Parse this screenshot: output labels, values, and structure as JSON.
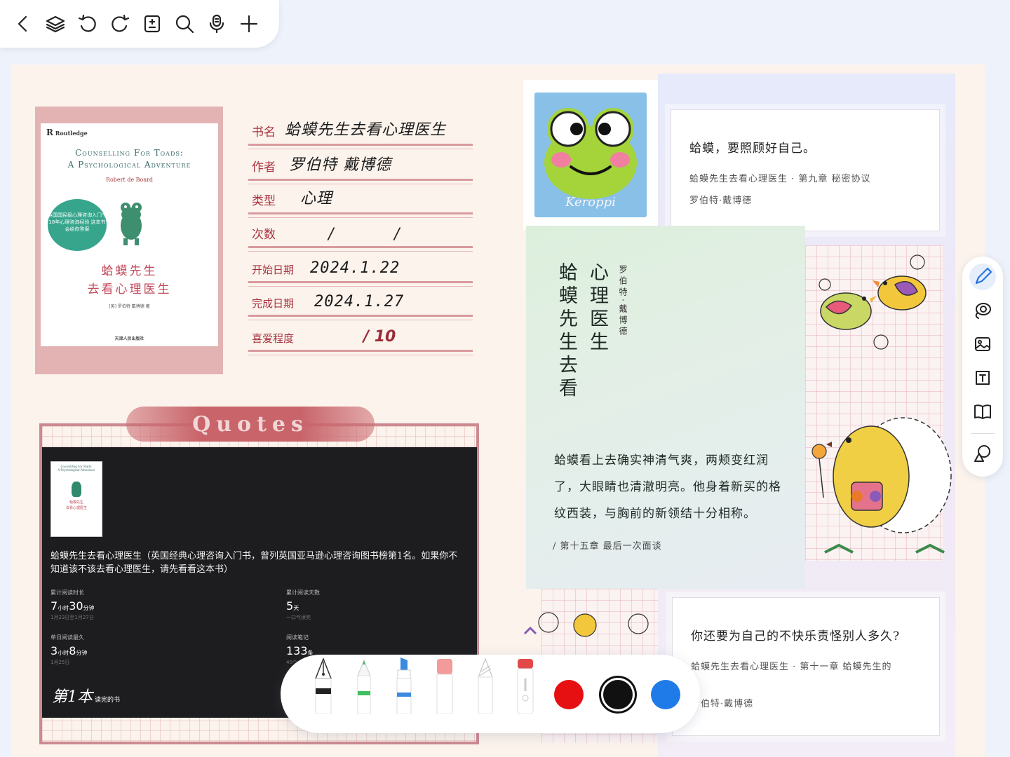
{
  "toolbar": {
    "icons": [
      "back-icon",
      "layers-icon",
      "undo-icon",
      "redo-icon",
      "page-sort-icon",
      "search-icon",
      "microphone-icon",
      "add-icon"
    ]
  },
  "cover": {
    "publisher": "Routledge",
    "en_title_line1": "Counselling For Toads:",
    "en_title_line2": "A Psychological Adventure",
    "author_en": "Robert de Board",
    "badge_text": "英国国民级心理咨询入门书 18年心理咨询经验 这本书会给你答案",
    "zh_title_line1": "蛤蟆先生",
    "zh_title_line2": "去看心理医生",
    "credit": "[英] 罗伯特·戴博德 著",
    "press": "天津人民出版社"
  },
  "info": {
    "book_label": "书名",
    "book_value": "蛤蟆先生去看心理医生",
    "author_label": "作者",
    "author_value": "罗伯特 戴博德",
    "type_label": "类型",
    "type_value": "心理",
    "times_label": "次数",
    "start_label": "开始日期",
    "start_value": "2024.1.22",
    "finish_label": "完成日期",
    "finish_value": "2024.1.27",
    "rating_label": "喜爱程度",
    "rating_value": "/ 10"
  },
  "quotes": {
    "banner": "Quotes",
    "description": "蛤蟆先生去看心理医生（英国经典心理咨询入门书，曾列英国亚马逊心理咨询图书榜第1名。如果你不知道该不该去看心理医生，请先看看这本书）",
    "stats": [
      {
        "label": "累计阅读时长",
        "value": "7",
        "unit1": "小时",
        "value2": "30",
        "unit2": "分钟",
        "sub": "1月23日至1月27日"
      },
      {
        "label": "累计阅读天数",
        "value": "5",
        "unit1": "天",
        "sub": "一口气读完"
      },
      {
        "label": "单日阅读最久",
        "value": "3",
        "unit1": "小时",
        "value2": "8",
        "unit2": "分钟",
        "sub": "1月25日"
      },
      {
        "label": "阅读笔记",
        "value": "133",
        "unit1": "条",
        "sub": "40个"
      }
    ],
    "count_value": "第1本",
    "count_label": "读完的书"
  },
  "keroppi": {
    "label": "Keroppi"
  },
  "green_card": {
    "title_col1": "蛤蟆先生去看",
    "title_col2": "心理医生",
    "author": "罗伯特·戴博德",
    "paragraph": "蛤蟆看上去确实神清气爽，两颊变红润了，大眼睛也清澈明亮。他身着新买的格纹西装，与胸前的新领结十分相称。",
    "source": "/ 第十五章 最后一次面谈"
  },
  "quote_cards": [
    {
      "main": "蛤蟆，要照顾好自己。",
      "source": "蛤蟆先生去看心理医生 · 第九章 秘密协议",
      "author": "罗伯特·戴博德"
    },
    {
      "main": "你还要为自己的不快乐责怪别人多久?",
      "source": "蛤蟆先生去看心理医生 · 第十一章 蛤蟆先生的",
      "author": "罗伯特·戴博德"
    }
  ],
  "right_rail": {
    "icons": [
      "pen-icon",
      "lasso-icon",
      "image-icon",
      "text-box-icon",
      "book-icon",
      "shapes-icon"
    ],
    "active": "pen-icon"
  },
  "pen_palette": {
    "tools": [
      "fountain-pen-icon",
      "green-pencil-icon",
      "blue-marker-icon",
      "eraser-icon",
      "pencil-icon",
      "lasso-pen-icon"
    ],
    "colors": [
      "#e60f12",
      "#111111",
      "#1f7be8"
    ],
    "selected_color": "#111111"
  }
}
